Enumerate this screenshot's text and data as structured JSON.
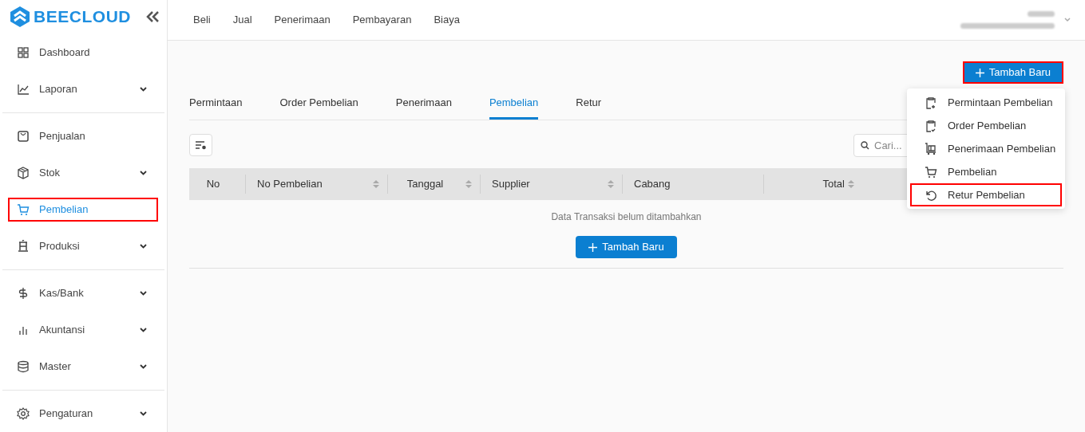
{
  "brand": {
    "name": "BEECLOUD"
  },
  "sidebar": {
    "groups": [
      {
        "items": [
          {
            "label": "Dashboard",
            "expandable": false,
            "selected": false,
            "highlighted": false
          },
          {
            "label": "Laporan",
            "expandable": true,
            "selected": false,
            "highlighted": false
          }
        ]
      },
      {
        "items": [
          {
            "label": "Penjualan",
            "expandable": false,
            "selected": false,
            "highlighted": false
          },
          {
            "label": "Stok",
            "expandable": true,
            "selected": false,
            "highlighted": false
          },
          {
            "label": "Pembelian",
            "expandable": false,
            "selected": true,
            "highlighted": true
          },
          {
            "label": "Produksi",
            "expandable": true,
            "selected": false,
            "highlighted": false
          }
        ]
      },
      {
        "items": [
          {
            "label": "Kas/Bank",
            "expandable": true,
            "selected": false,
            "highlighted": false
          },
          {
            "label": "Akuntansi",
            "expandable": true,
            "selected": false,
            "highlighted": false
          },
          {
            "label": "Master",
            "expandable": true,
            "selected": false,
            "highlighted": false
          }
        ]
      },
      {
        "items": [
          {
            "label": "Pengaturan",
            "expandable": true,
            "selected": false,
            "highlighted": false
          }
        ]
      }
    ]
  },
  "top_nav": [
    "Beli",
    "Jual",
    "Penerimaan",
    "Pembayaran",
    "Biaya"
  ],
  "add_button": {
    "label": "Tambah Baru",
    "highlighted": true
  },
  "tabs": [
    {
      "label": "Permintaan",
      "selected": false
    },
    {
      "label": "Order Pembelian",
      "selected": false
    },
    {
      "label": "Penerimaan",
      "selected": false
    },
    {
      "label": "Pembelian",
      "selected": true
    },
    {
      "label": "Retur",
      "selected": false
    }
  ],
  "search": {
    "placeholder": "Cari..."
  },
  "table": {
    "columns": [
      {
        "label": "No",
        "sortable": false
      },
      {
        "label": "No Pembelian",
        "sortable": true
      },
      {
        "label": "Tanggal",
        "sortable": true
      },
      {
        "label": "Supplier",
        "sortable": true
      },
      {
        "label": "Cabang",
        "sortable": false
      },
      {
        "label": "Total",
        "sortable": true
      }
    ],
    "empty_message": "Data Transaksi belum ditambahkan",
    "empty_button": "Tambah Baru"
  },
  "dropdown": {
    "items": [
      {
        "label": "Permintaan Pembelian",
        "highlighted": false
      },
      {
        "label": "Order Pembelian",
        "highlighted": false
      },
      {
        "label": "Penerimaan Pembelian",
        "highlighted": false
      },
      {
        "label": "Pembelian",
        "highlighted": false
      },
      {
        "label": "Retur Pembelian",
        "highlighted": true
      }
    ]
  }
}
